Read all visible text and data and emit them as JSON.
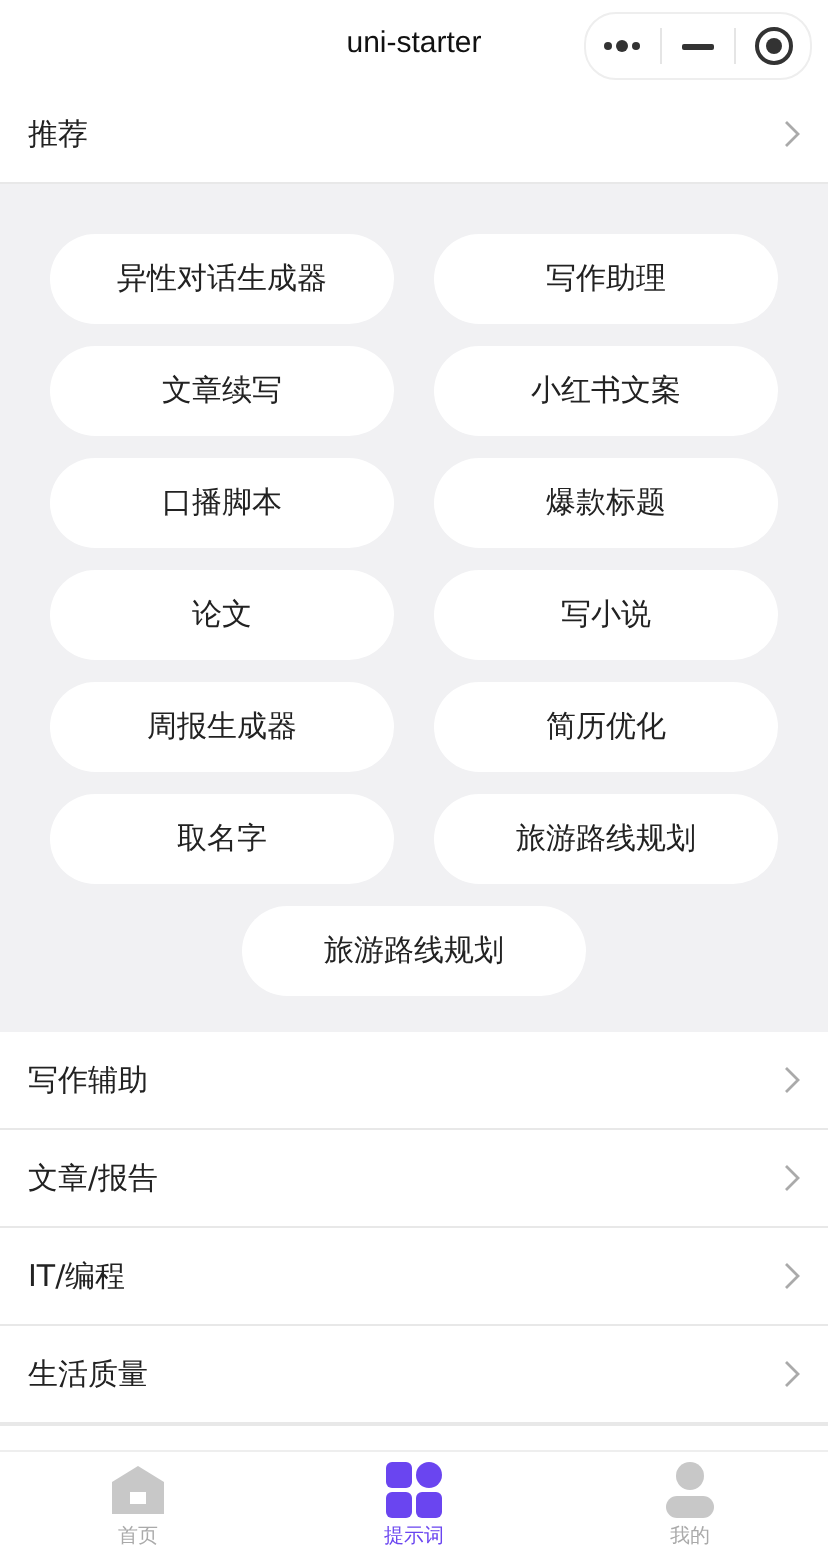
{
  "title": "uni-starter",
  "section": {
    "label": "推荐",
    "expanded": true
  },
  "prompts": [
    "异性对话生成器",
    "写作助理",
    "文章续写",
    "小红书文案",
    "口播脚本",
    "爆款标题",
    "论文",
    "写小说",
    "周报生成器",
    "简历优化",
    "取名字",
    "旅游路线规划",
    "旅游路线规划"
  ],
  "categories": [
    "写作辅助",
    "文章/报告",
    "IT/编程",
    "生活质量"
  ],
  "tabs": [
    {
      "label": "首页",
      "kind": "home",
      "selected": false
    },
    {
      "label": "提示词",
      "kind": "grid",
      "selected": true
    },
    {
      "label": "我的",
      "kind": "person",
      "selected": false
    }
  ]
}
